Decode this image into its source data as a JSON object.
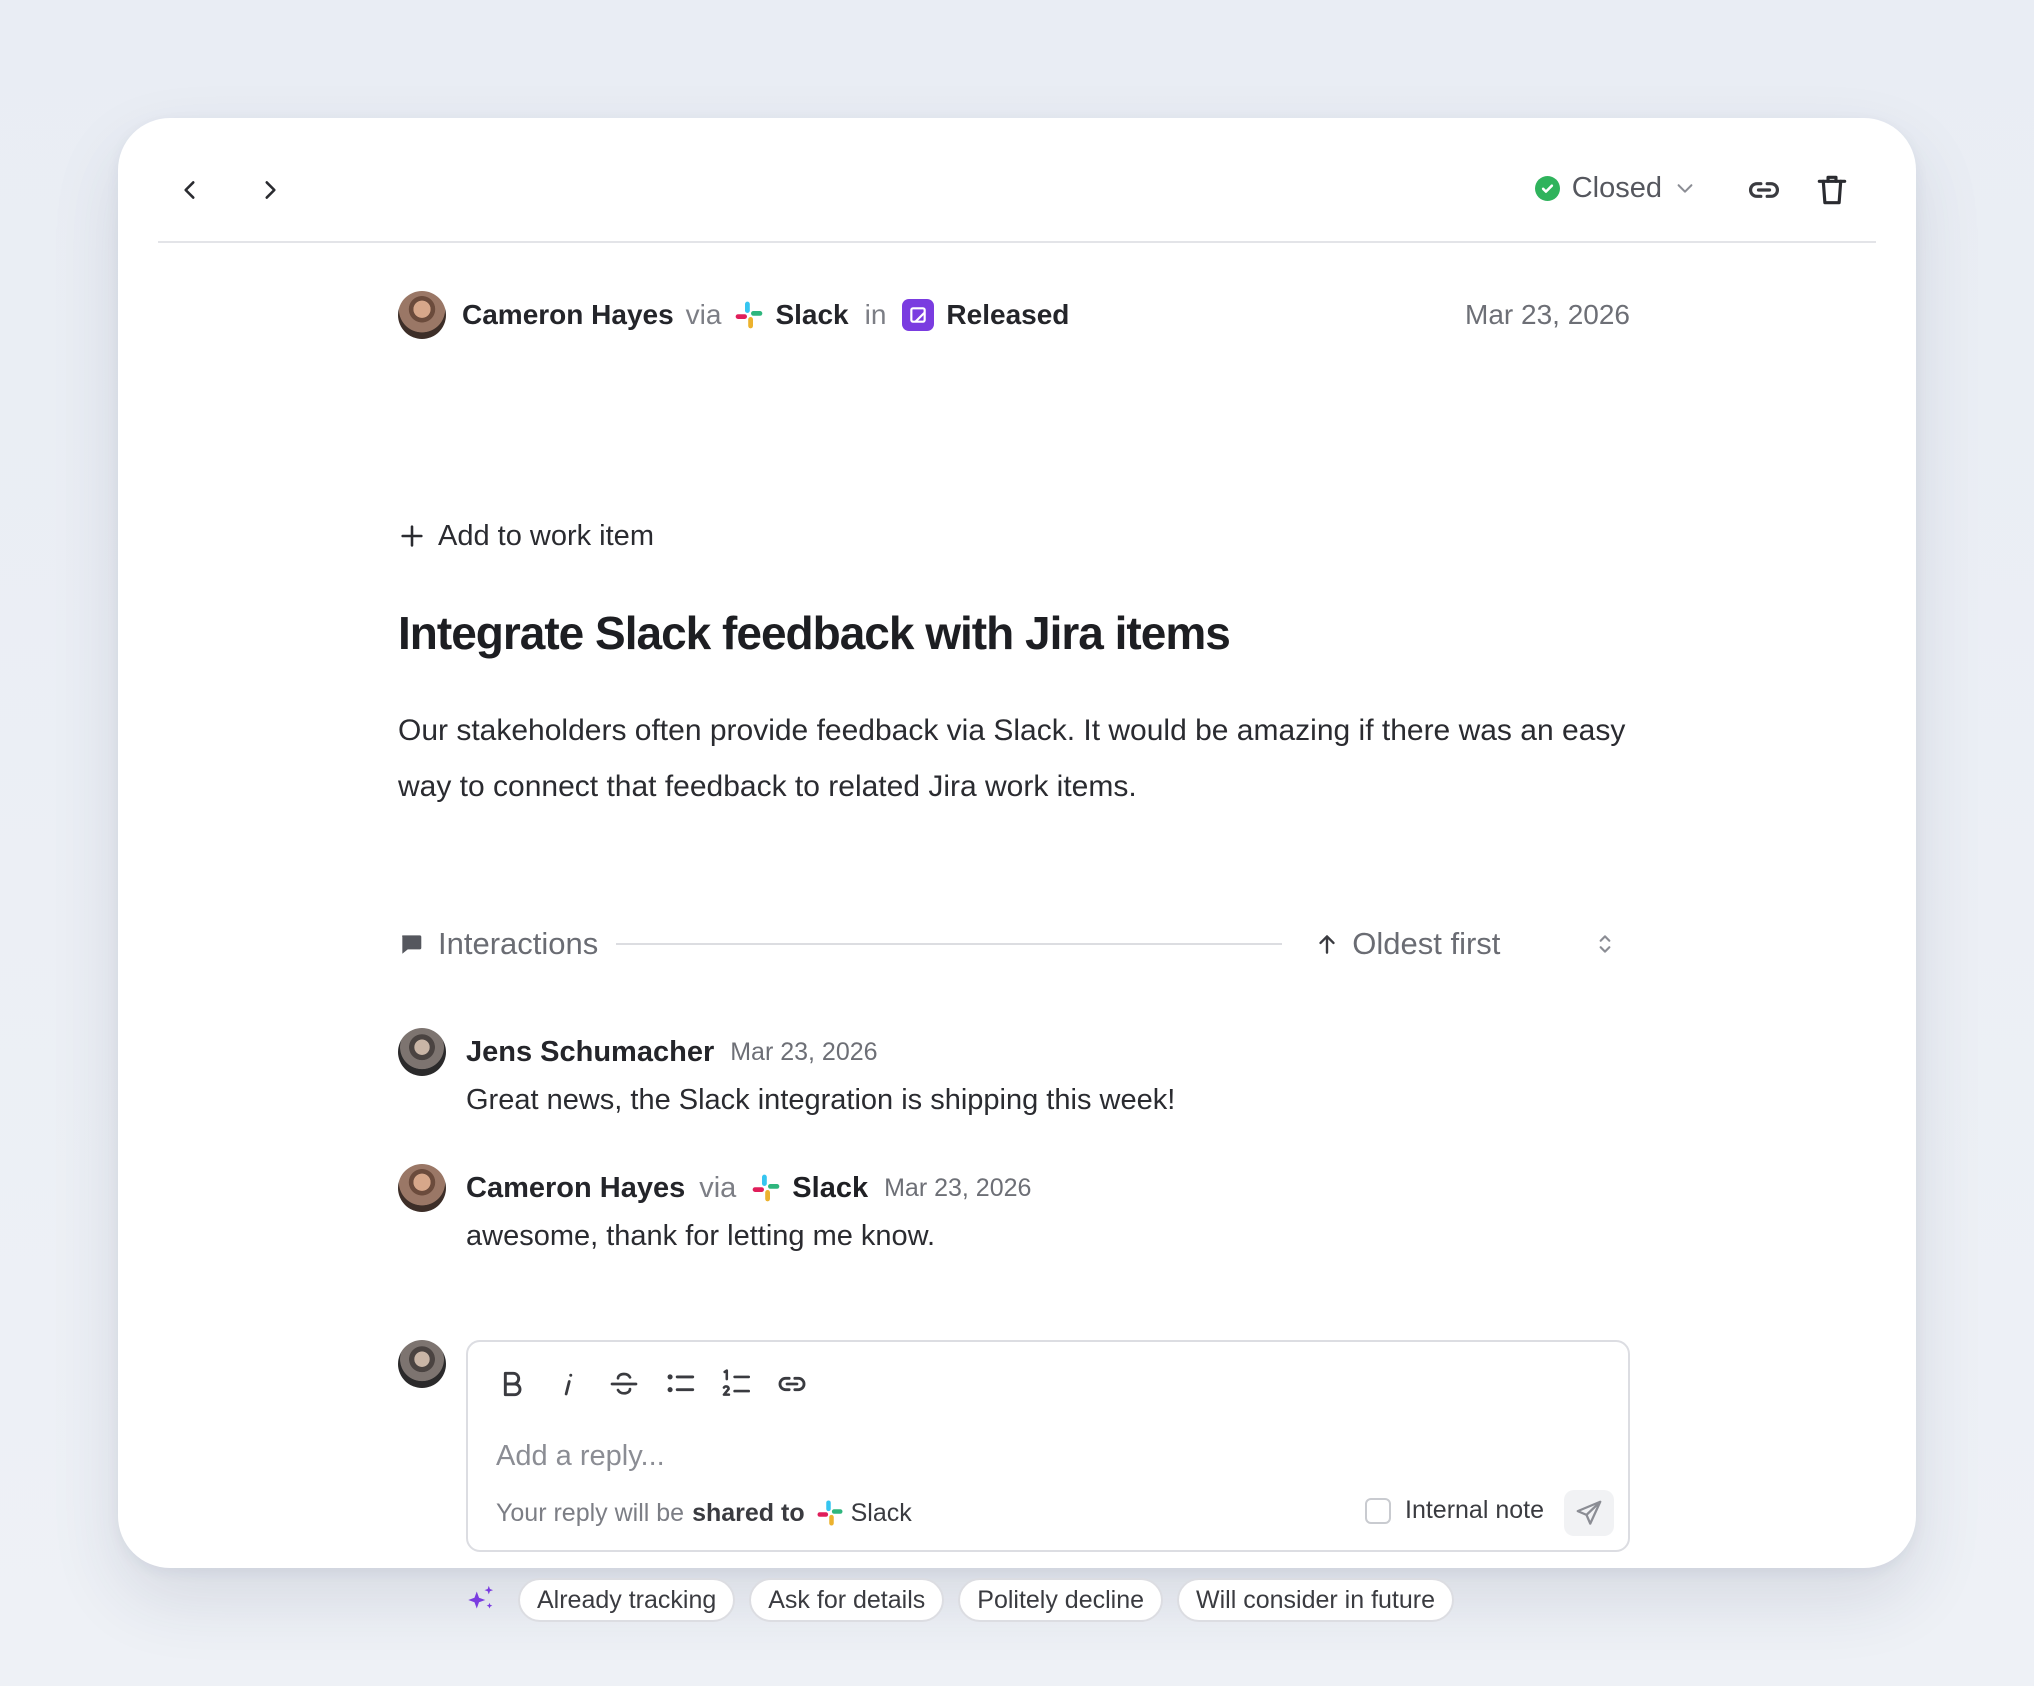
{
  "status": {
    "label": "Closed",
    "color": "#2fb35c"
  },
  "feedback": {
    "author": "Cameron Hayes",
    "via_word": "via",
    "source": "Slack",
    "in_word": "in",
    "release": "Released",
    "date": "Mar 23, 2026",
    "add_to_work_item": "Add to work item",
    "title": "Integrate Slack feedback with Jira items",
    "description": "Our stakeholders often provide feedback via Slack. It would be amazing if there was an easy way to connect that feedback to related Jira work items."
  },
  "interactions": {
    "label": "Interactions",
    "sort_label": "Oldest first",
    "comments": [
      {
        "author": "Jens Schumacher",
        "date": "Mar 23, 2026",
        "text": "Great news, the Slack integration is shipping this week!"
      },
      {
        "author": "Cameron Hayes",
        "via_word": "via",
        "source": "Slack",
        "date": "Mar 23, 2026",
        "text": "awesome, thank for letting me know."
      }
    ]
  },
  "reply": {
    "placeholder": "Add a reply...",
    "share_prefix": "Your reply will be",
    "share_bold": "shared to",
    "share_target": "Slack",
    "internal_note": "Internal note"
  },
  "suggestions": [
    "Already tracking",
    "Ask for details",
    "Politely decline",
    "Will consider in future"
  ],
  "colors": {
    "accent_purple": "#7a3ce0",
    "status_green": "#2fb35c"
  }
}
